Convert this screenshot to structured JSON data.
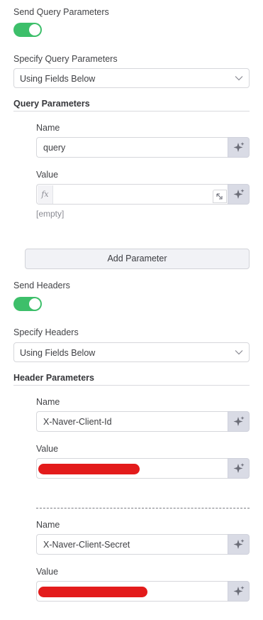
{
  "query": {
    "send_label": "Send Query Parameters",
    "send_enabled": true,
    "specify_label": "Specify Query Parameters",
    "specify_value": "Using Fields Below",
    "section_title": "Query Parameters",
    "params": [
      {
        "name_label": "Name",
        "name_value": "query",
        "value_label": "Value",
        "value_value": "",
        "value_hint": "[empty]",
        "fx_label": "fx"
      }
    ],
    "add_button": "Add Parameter"
  },
  "headers": {
    "send_label": "Send Headers",
    "send_enabled": true,
    "specify_label": "Specify Headers",
    "specify_value": "Using Fields Below",
    "section_title": "Header Parameters",
    "params": [
      {
        "name_label": "Name",
        "name_value": "X-Naver-Client-Id",
        "value_label": "Value"
      },
      {
        "name_label": "Name",
        "name_value": "X-Naver-Client-Secret",
        "value_label": "Value"
      }
    ]
  },
  "colors": {
    "toggle_on": "#3dbf6a",
    "ai_button_bg": "#d9dbe5",
    "redaction": "#e31b1b"
  },
  "icons": {
    "ai": "sparkles-icon",
    "dropdown": "chevron-down-icon",
    "expand": "expand-icon"
  }
}
